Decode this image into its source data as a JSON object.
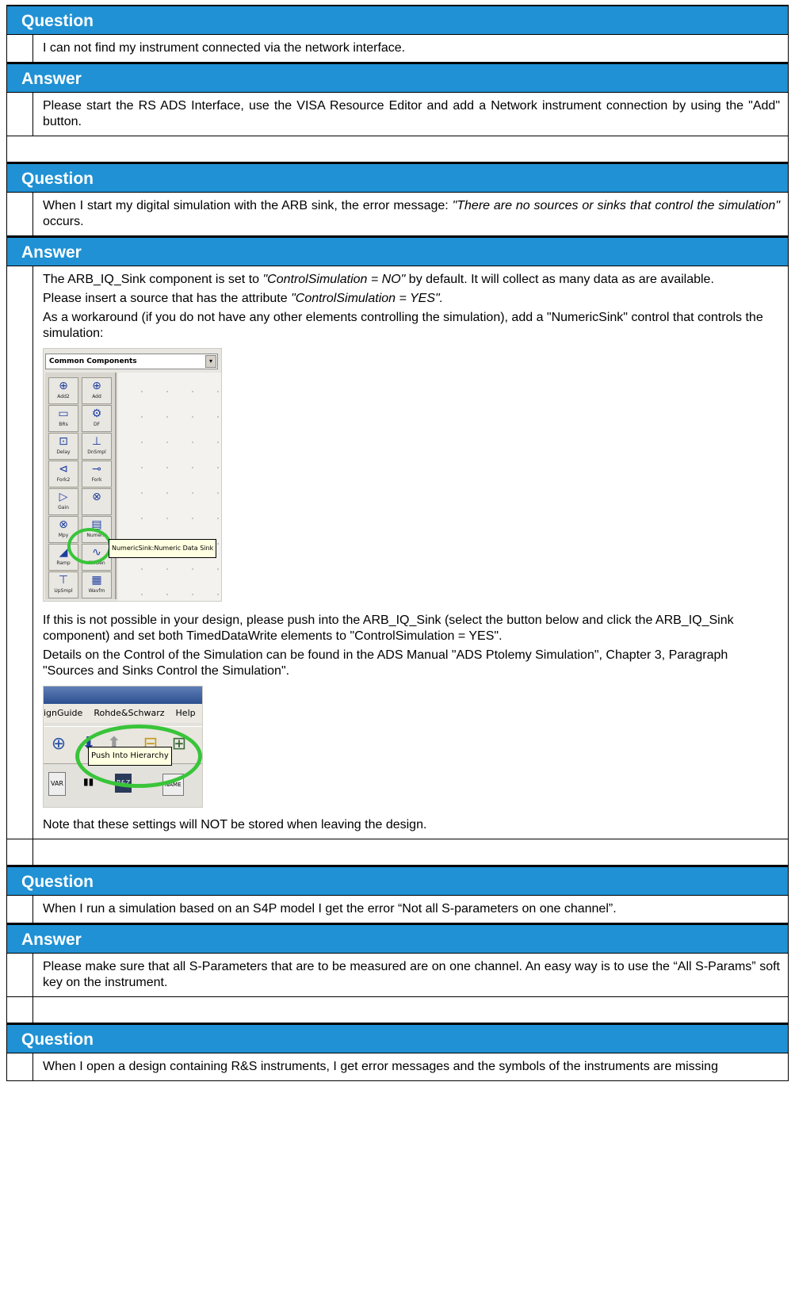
{
  "colors": {
    "header_bg": "#1f91d4",
    "header_text": "#ffffff",
    "highlight_ring": "#39c43a"
  },
  "faq": [
    {
      "question_label": "Question",
      "question": "I can not find my instrument connected via the network interface.",
      "answer_label": "Answer",
      "answer": "Please start the RS ADS Interface, use the VISA Resource Editor and add a Network instrument connection by using the \"Add\" button."
    },
    {
      "question_label": "Question",
      "question_start": "When I start my digital simulation with the ARB sink, the error message: ",
      "question_italic": "\"There are no sources or sinks that control the simulation\"",
      "question_end": " occurs.",
      "answer_label": "Answer",
      "a1_start": "The ARB_IQ_Sink component is set to ",
      "a1_italic": "\"ControlSimulation = NO\"",
      "a1_end": " by default. It will collect as many data as are available.",
      "a2_start": "Please insert a source that has the attribute ",
      "a2_italic": "\"ControlSimulation = YES\".",
      "a3": "As a workaround (if you do not have any other elements controlling the simulation), add a \"NumericSink\" control that controls the simulation:",
      "a4": "If this is not possible in your design, please push into the ARB_IQ_Sink (select the button below and click the ARB_IQ_Sink component) and set both TimedDataWrite elements to \"ControlSimulation = YES\".",
      "a5": "Details on the Control of the Simulation can be found in the ADS Manual \"ADS Ptolemy Simulation\", Chapter 3, Paragraph \"Sources and Sinks Control the Simulation\".",
      "a6": "Note that these settings will NOT be stored when leaving the design."
    },
    {
      "question_label": "Question",
      "question": "When I run a simulation based on an S4P model I get the error “Not all S-parameters on one channel”.",
      "answer_label": "Answer",
      "answer": "Please make sure that all S-Parameters that are to be measured are on one channel. An easy way is to use the “All S-Params” soft key on the instrument."
    },
    {
      "question_label": "Question",
      "question": "When I open a design containing R&S instruments, I get error messages and the symbols of the instruments are missing"
    }
  ],
  "screenshot_palette": {
    "dropdown": "Common Components",
    "dropdown_arrow": "▾",
    "items": [
      {
        "sym": "⊕",
        "label": "Add2"
      },
      {
        "sym": "⊕",
        "label": "Add"
      },
      {
        "sym": "▭",
        "label": "BRs"
      },
      {
        "sym": "⚙",
        "label": "DF"
      },
      {
        "sym": "⊡",
        "label": "Delay"
      },
      {
        "sym": "⊥",
        "label": "DnSmpl"
      },
      {
        "sym": "⊲",
        "label": "Fork2"
      },
      {
        "sym": "⊸",
        "label": "Fork"
      },
      {
        "sym": "▷",
        "label": "Gain"
      },
      {
        "sym": "⊗",
        "label": ""
      },
      {
        "sym": "⊗",
        "label": "Mpy"
      },
      {
        "sym": "▤",
        "label": "Numeric"
      },
      {
        "sym": "◢",
        "label": "Ramp"
      },
      {
        "sym": "∿",
        "label": "SinGen"
      },
      {
        "sym": "⊤",
        "label": "UpSmpl"
      },
      {
        "sym": "▦",
        "label": "Wavfm"
      }
    ],
    "tooltip": "NumericSink:Numeric Data Sink"
  },
  "screenshot_toolbar": {
    "menu_items": [
      "ignGuide",
      "Rohde&Schwarz",
      "Help"
    ],
    "tooltip": "Push Into Hierarchy",
    "icons": [
      "⊕",
      "⬇",
      "⬆",
      "⊟",
      "⊞"
    ],
    "row2": [
      "VAR",
      "▮▮",
      "R&Z",
      "NAME"
    ]
  }
}
